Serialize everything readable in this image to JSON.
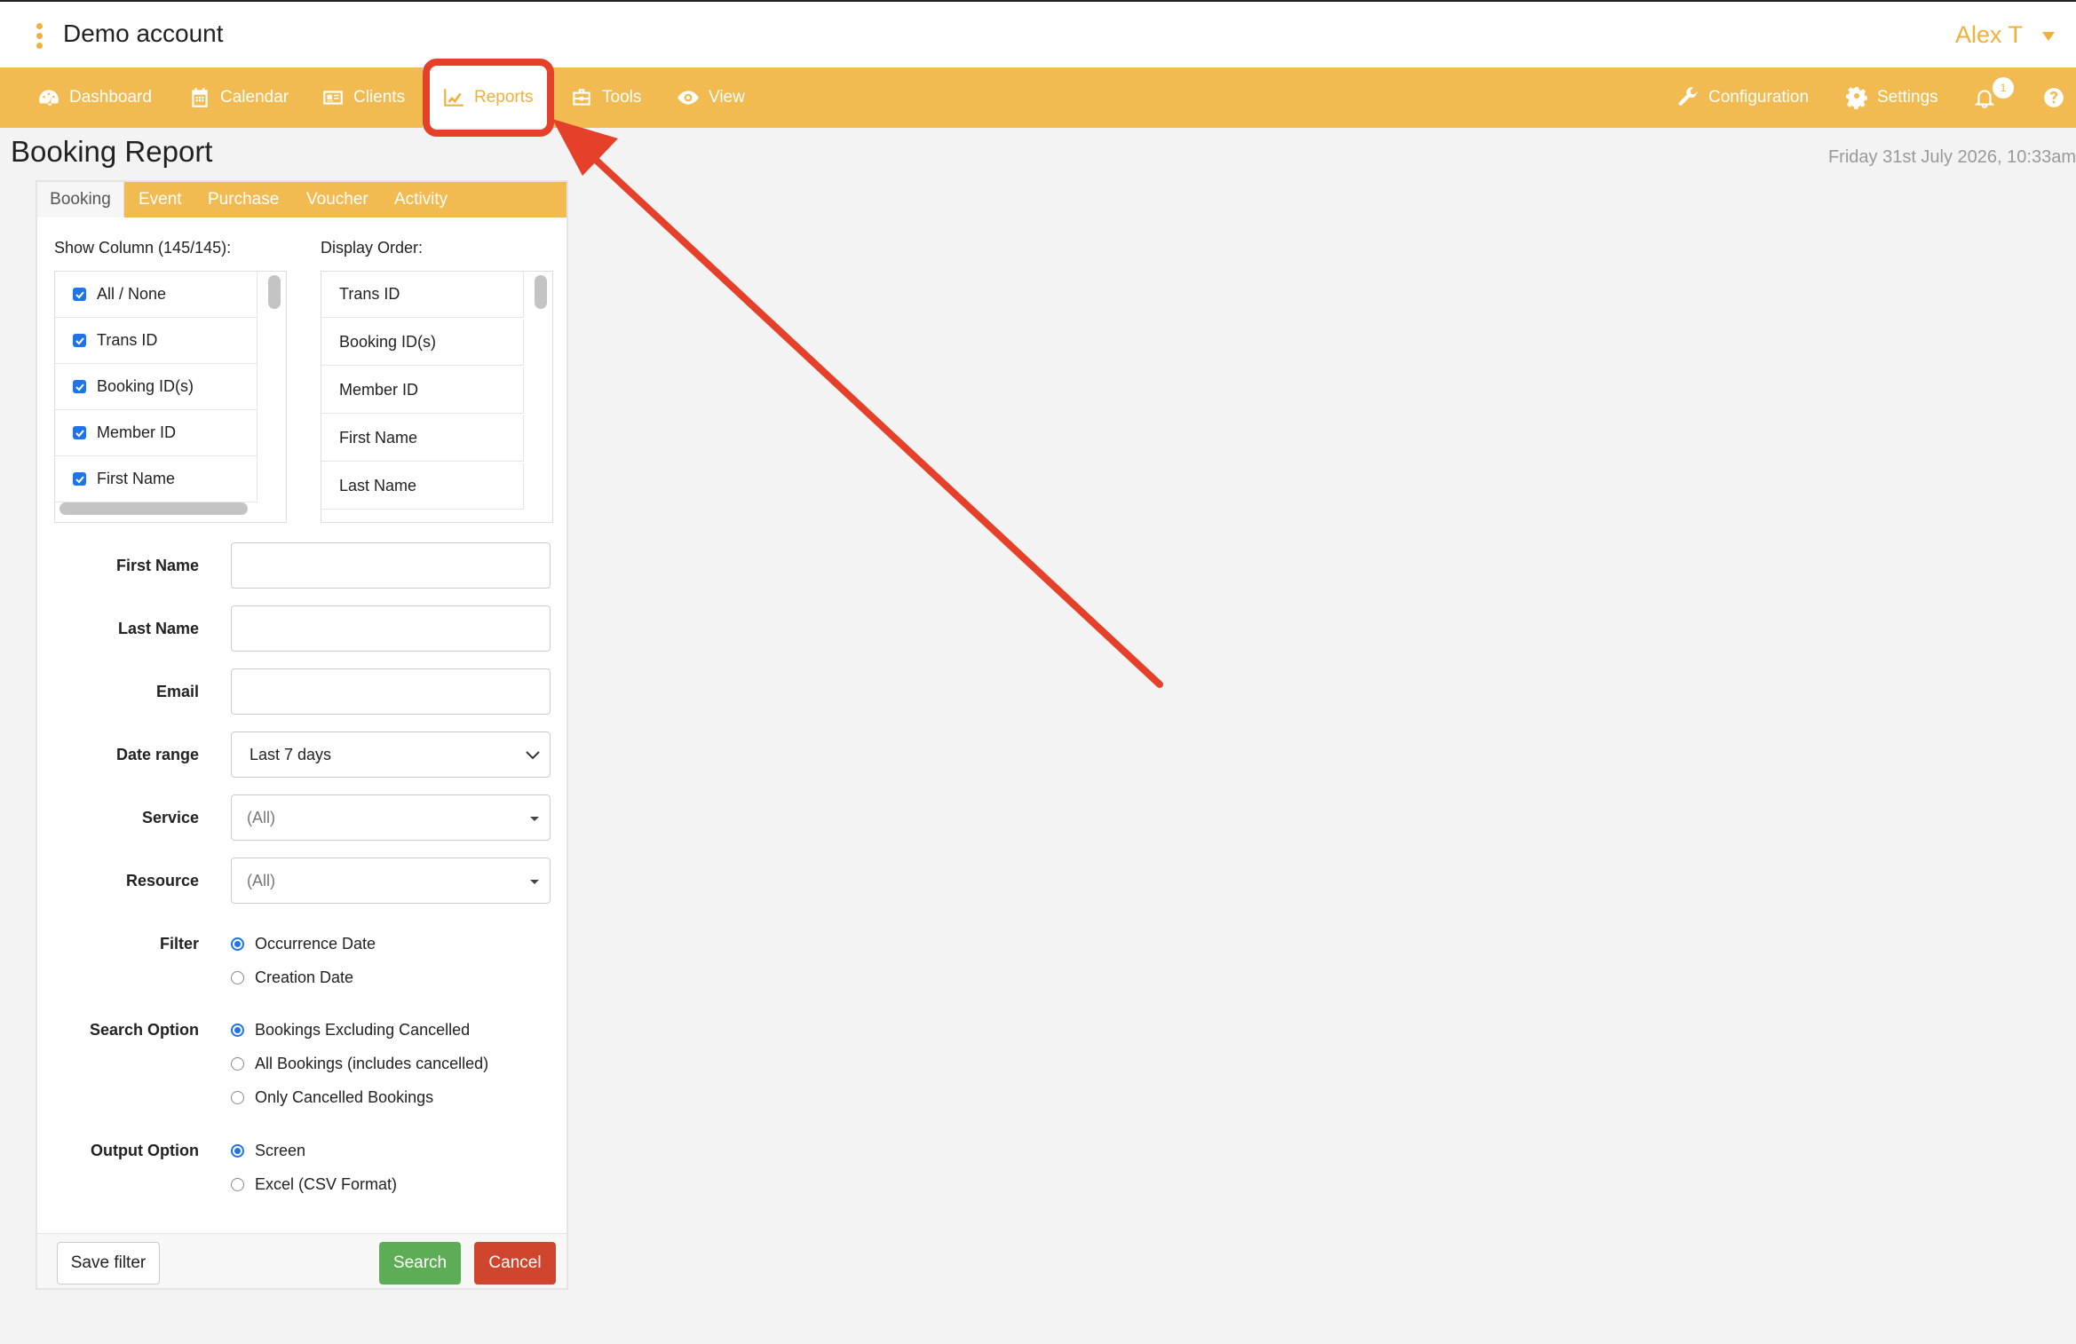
{
  "header": {
    "account_name": "Demo account",
    "user_name": "Alex T"
  },
  "nav": {
    "dashboard": "Dashboard",
    "calendar": "Calendar",
    "clients": "Clients",
    "reports": "Reports",
    "tools": "Tools",
    "view": "View",
    "configuration": "Configuration",
    "settings": "Settings",
    "notifications_count": "1"
  },
  "page": {
    "title": "Booking Report",
    "date": "Friday 31st July 2026, 10:33am"
  },
  "tabs": [
    "Booking",
    "Event",
    "Purchase",
    "Voucher",
    "Activity"
  ],
  "columns": {
    "show_label": "Show Column (145/145):",
    "order_label": "Display Order:",
    "show_items": [
      "All / None",
      "Trans ID",
      "Booking ID(s)",
      "Member ID",
      "First Name"
    ],
    "order_items": [
      "Trans ID",
      "Booking ID(s)",
      "Member ID",
      "First Name",
      "Last Name"
    ]
  },
  "form": {
    "first_name_label": "First Name",
    "last_name_label": "Last Name",
    "email_label": "Email",
    "date_range_label": "Date range",
    "date_range_value": "Last 7 days",
    "service_label": "Service",
    "service_value": "(All)",
    "resource_label": "Resource",
    "resource_value": "(All)",
    "filter_label": "Filter",
    "filter_options": [
      "Occurrence Date",
      "Creation Date"
    ],
    "search_option_label": "Search Option",
    "search_options": [
      "Bookings Excluding Cancelled",
      "All Bookings (includes cancelled)",
      "Only Cancelled Bookings"
    ],
    "output_option_label": "Output Option",
    "output_options": [
      "Screen",
      "Excel (CSV Format)"
    ]
  },
  "buttons": {
    "save_filter": "Save filter",
    "search": "Search",
    "cancel": "Cancel"
  },
  "colors": {
    "brand": "#f2bb52",
    "annotation": "#e5402a",
    "search_button": "#5cad55",
    "cancel_button": "#d0452e",
    "checkbox": "#1e74e8"
  }
}
